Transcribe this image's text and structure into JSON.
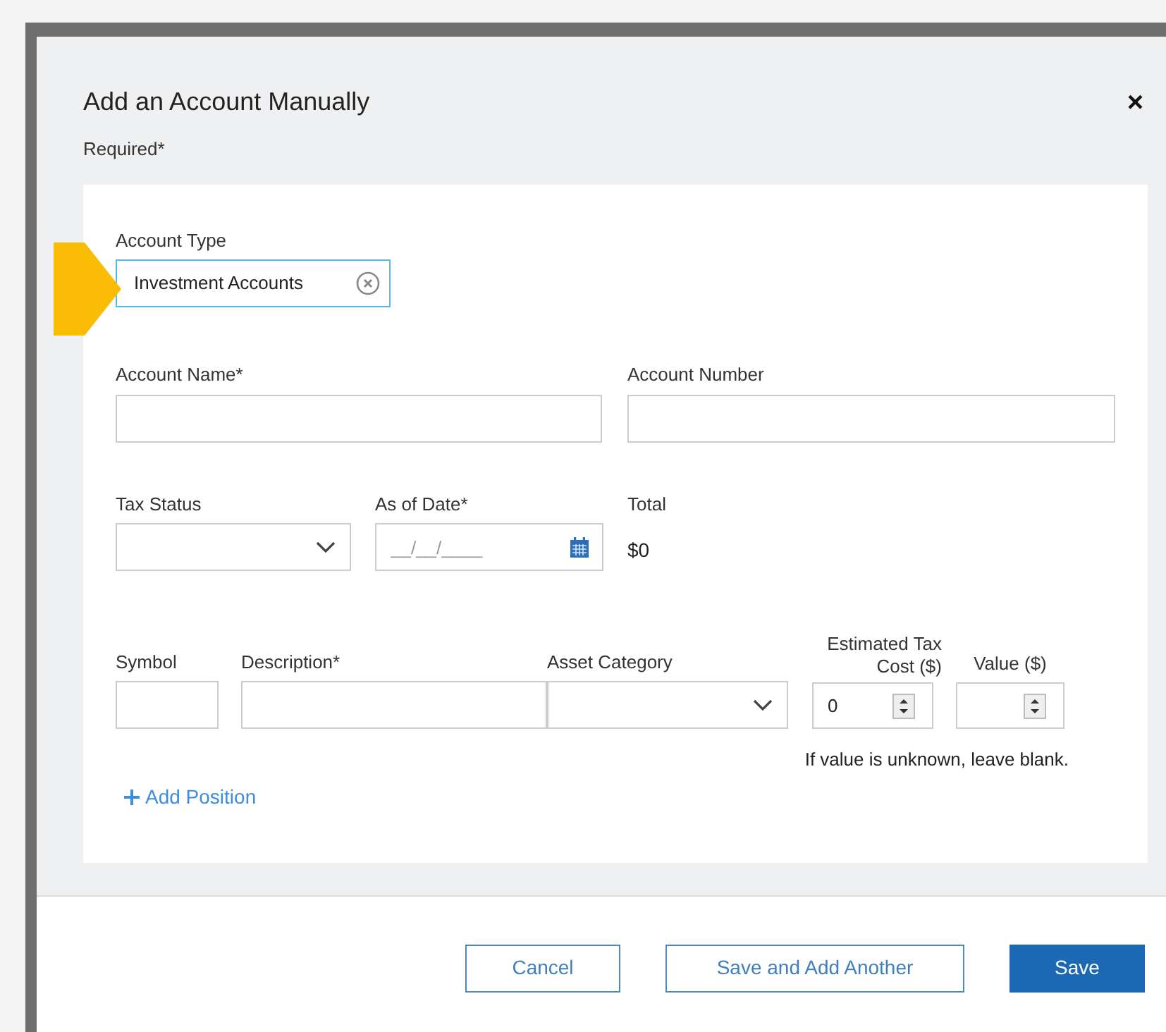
{
  "dialog": {
    "title": "Add an Account Manually",
    "close": "×",
    "required_note": "Required*"
  },
  "account_type": {
    "label": "Account Type",
    "value": "Investment Accounts"
  },
  "account_name": {
    "label": "Account Name*"
  },
  "account_number": {
    "label": "Account Number"
  },
  "tax_status": {
    "label": "Tax Status"
  },
  "as_of_date": {
    "label": "As of Date*",
    "placeholder": "__/__/____"
  },
  "total": {
    "label": "Total",
    "value": "$0"
  },
  "position": {
    "symbol": {
      "label": "Symbol"
    },
    "description": {
      "label": "Description*"
    },
    "asset_category": {
      "label": "Asset Category"
    },
    "estimated_tax_cost": {
      "label_lines": [
        "Estimated Tax",
        "Cost ($)"
      ],
      "value": "0"
    },
    "value": {
      "label": "Value ($)"
    },
    "hint": "If value is unknown, leave blank."
  },
  "add_position": {
    "label": "Add Position"
  },
  "buttons": [
    {
      "label": "Cancel",
      "kind": "secondary"
    },
    {
      "label": "Save and Add Another",
      "kind": "secondary"
    },
    {
      "label": "Save",
      "kind": "primary"
    }
  ]
}
